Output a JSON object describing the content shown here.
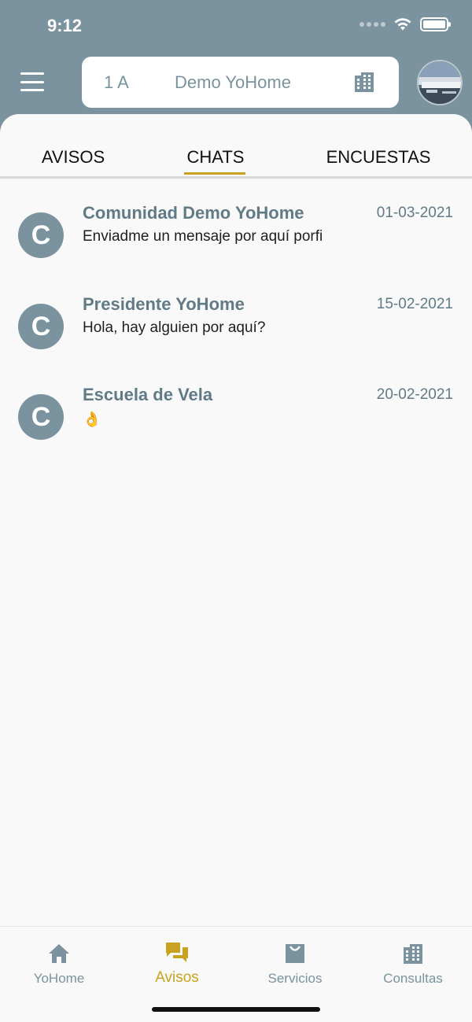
{
  "status_bar": {
    "time": "9:12"
  },
  "header": {
    "unit_code": "1 A",
    "community_name": "Demo YoHome"
  },
  "tabs": [
    {
      "label": "AVISOS"
    },
    {
      "label": "CHATS",
      "active": true
    },
    {
      "label": "ENCUESTAS"
    }
  ],
  "chats": [
    {
      "initial": "C",
      "name": "Comunidad Demo YoHome",
      "date": "01-03-2021",
      "preview": "Enviadme un mensaje por aquí porfi"
    },
    {
      "initial": "C",
      "name": "Presidente YoHome",
      "date": "15-02-2021",
      "preview": "Hola, hay alguien por aquí?"
    },
    {
      "initial": "C",
      "name": "Escuela de Vela",
      "date": "20-02-2021",
      "preview": "👌"
    }
  ],
  "bottom_nav": [
    {
      "label": "YoHome",
      "icon": "home-icon"
    },
    {
      "label": "Avisos",
      "icon": "chat-bubbles-icon",
      "active": true
    },
    {
      "label": "Servicios",
      "icon": "shopping-bag-icon"
    },
    {
      "label": "Consultas",
      "icon": "building-icon"
    }
  ],
  "colors": {
    "header_bg": "#7a939e",
    "accent": "#c9a31f",
    "text_muted": "#607a86"
  }
}
